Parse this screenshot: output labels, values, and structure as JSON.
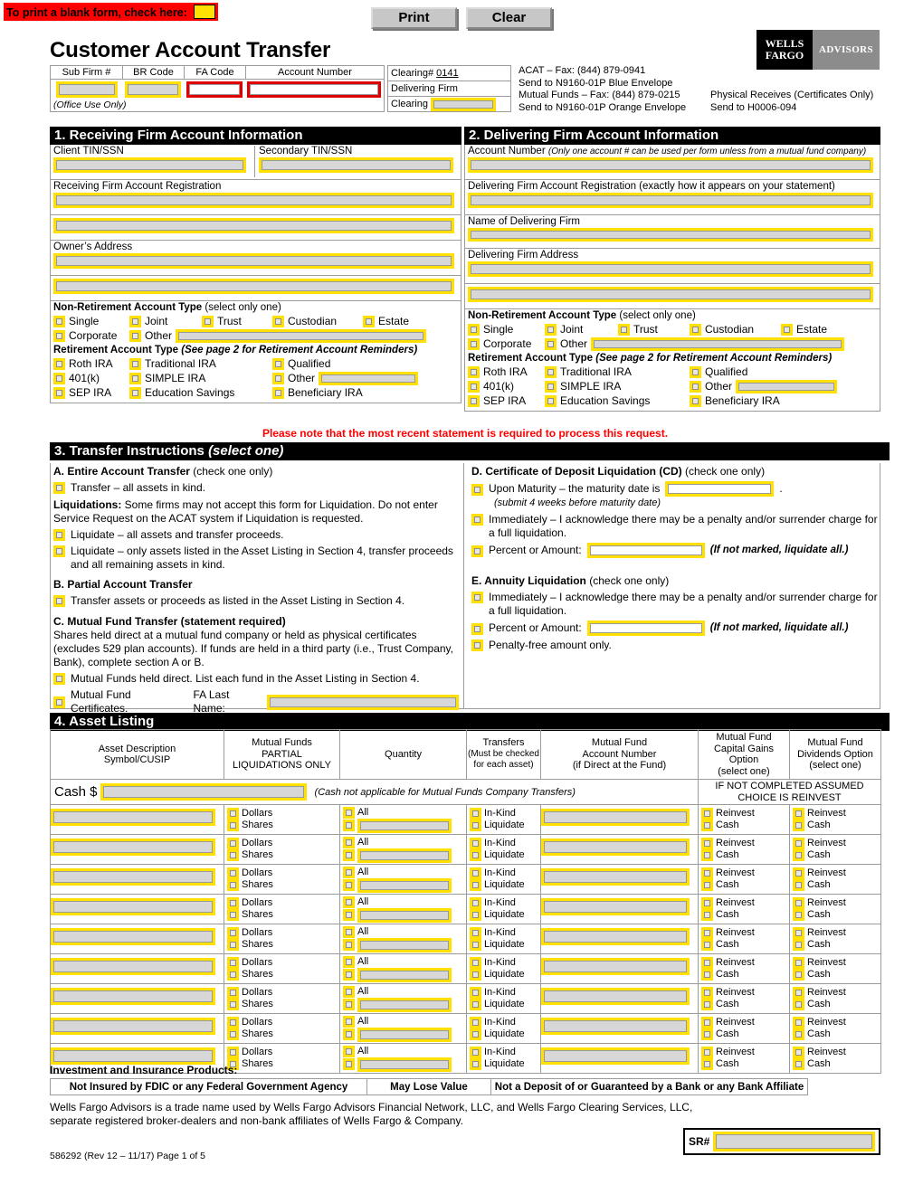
{
  "top": {
    "print_notice": "To print a blank form, check here:",
    "print_button": "Print",
    "clear_button": "Clear"
  },
  "header": {
    "title": "Customer Account Transfer",
    "logo_primary": "WELLS FARGO",
    "logo_secondary": "ADVISORS",
    "office_table": {
      "columns": [
        "Sub Firm #",
        "BR Code",
        "FA Code",
        "Account Number"
      ],
      "note": "(Office Use Only)"
    },
    "clearing": {
      "clearing_label": "Clearing#",
      "clearing_value": "0141",
      "delivering_firm_label": "Delivering Firm",
      "delivering_clearing_label": "Clearing"
    },
    "fax_info": {
      "acat_fax": "ACAT – Fax: (844) 879-0941",
      "acat_send": "Send to N9160-01P Blue Envelope",
      "mf_fax": "Mutual Funds – Fax: (844) 879-0215",
      "mf_send": "Send to N9160-01P Orange Envelope",
      "physical": "Physical Receives (Certificates Only)",
      "physical_send": "Send to H0006-094"
    }
  },
  "section1": {
    "title": "1. Receiving Firm Account Information",
    "client_tin_label": "Client TIN/SSN",
    "secondary_tin_label": "Secondary TIN/SSN",
    "registration_label": "Receiving Firm Account Registration",
    "address_label": "Owner’s Address"
  },
  "section2": {
    "title": "2. Delivering Firm Account Information",
    "account_number_label": "Account Number",
    "account_number_note": "(Only one account # can be used per form unless from a mutual fund company)",
    "registration_label": "Delivering Firm Account Registration (exactly how it appears on your statement)",
    "firm_name_label": "Name of Delivering Firm",
    "address_label": "Delivering Firm Address"
  },
  "account_types": {
    "nonret_heading": "Non-Retirement Account Type",
    "nonret_note": "(select only one)",
    "nonret_row1": [
      "Single",
      "Joint",
      "Trust",
      "Custodian",
      "Estate"
    ],
    "nonret_row2": [
      "Corporate",
      "Other"
    ],
    "ret_heading": "Retirement Account Type",
    "ret_note": "(See page 2 for Retirement Account Reminders)",
    "ret_row1": [
      "Roth IRA",
      "Traditional IRA",
      "Qualified"
    ],
    "ret_row2": [
      "401(k)",
      "SIMPLE IRA",
      "Other"
    ],
    "ret_row3": [
      "SEP IRA",
      "Education Savings",
      "Beneficiary IRA"
    ]
  },
  "red_note": "Please note that the most recent statement is required to process this request.",
  "section3": {
    "title": "3. Transfer Instructions",
    "title_note": "(select one)",
    "a_heading": "A.  Entire Account Transfer",
    "a_note": "(check one only)",
    "a_item1": "Transfer – all assets in kind.",
    "liq_bold": "Liquidations:",
    "liq_text": " Some firms may not accept this form for Liquidation. Do not enter Service Request on the ACAT system if Liquidation is requested.",
    "a_item2": "Liquidate – all assets and transfer proceeds.",
    "a_item3": "Liquidate – only assets listed in the Asset Listing in Section 4, transfer proceeds and all remaining assets in kind.",
    "b_heading": "B.  Partial Account Transfer",
    "b_item1": "Transfer assets or proceeds as listed in the Asset Listing in Section 4.",
    "c_heading": "C.  Mutual Fund Transfer (statement required)",
    "c_text": "Shares held direct at a mutual fund company or held as physical certificates (excludes 529 plan accounts).  If funds are held in a third party (i.e., Trust Company, Bank), complete section A or B.",
    "c_item1": "Mutual Funds held direct. List each fund in the Asset Listing in Section 4.",
    "c_item2": "Mutual Fund Certificates.",
    "c_fa_label": "FA Last Name:",
    "d_heading": "D.  Certificate of Deposit Liquidation (CD)",
    "d_note": "(check one only)",
    "d_item1_pre": "Upon Maturity – the maturity date is",
    "d_item1_post": ".",
    "d_subnote": "(submit 4 weeks before maturity date)",
    "d_item2": "Immediately – I acknowledge there may be a penalty and/or surrender charge for a full liquidation.",
    "d_item3": "Percent or Amount:",
    "d_item3_note": "(If not marked, liquidate all.)",
    "e_heading": "E.  Annuity Liquidation",
    "e_note": "(check one only)",
    "e_item1": "Immediately – I acknowledge there may be a penalty and/or surrender charge for a full liquidation.",
    "e_item2": "Percent or Amount:",
    "e_item2_note": "(If not marked, liquidate all.)",
    "e_item3": "Penalty-free amount only."
  },
  "section4": {
    "title": "4. Asset Listing",
    "columns": [
      "Asset Description\nSymbol/CUSIP",
      "Mutual Funds\nPARTIAL\nLIQUIDATIONS ONLY",
      "Quantity",
      "Transfers\n(Must be checked\nfor each asset)",
      "Mutual Fund\nAccount Number\n(if Direct at the Fund)",
      "Mutual Fund\nCapital Gains Option\n(select one)",
      "Mutual Fund\nDividends Option\n(select one)"
    ],
    "col1_l1": "Asset Description",
    "col1_l2": "Symbol/CUSIP",
    "col2_l1": "Mutual Funds",
    "col2_l2": "PARTIAL",
    "col2_l3": "LIQUIDATIONS ONLY",
    "col3_l1": "Quantity",
    "col4_l1": "Transfers",
    "col4_l2": "(Must be checked",
    "col4_l3": "for each asset)",
    "col5_l1": "Mutual Fund",
    "col5_l2": "Account Number",
    "col5_l3": "(if Direct at the Fund)",
    "col6_l1": "Mutual Fund",
    "col6_l2": "Capital Gains Option",
    "col6_l3": "(select one)",
    "col7_l1": "Mutual Fund",
    "col7_l2": "Dividends Option",
    "col7_l3": "(select one)",
    "cash_label": "Cash $",
    "cash_note": "(Cash not applicable for Mutual Funds Company Transfers)",
    "assumed_l1": "IF NOT COMPLETED ASSUMED",
    "assumed_l2": "CHOICE IS REINVEST",
    "row_options": {
      "dollars": "Dollars",
      "shares": "Shares",
      "all": "All",
      "in_kind": "In-Kind",
      "liquidate": "Liquidate",
      "reinvest": "Reinvest",
      "cash": "Cash"
    },
    "row_count": 9
  },
  "footer": {
    "insurance_heading": "Investment and Insurance Products:",
    "disclosure_cells": [
      "Not Insured by FDIC or any Federal Government Agency",
      "May Lose Value",
      "Not a Deposit of or Guaranteed by a Bank or any Bank Affiliate"
    ],
    "legal_l1": "Wells Fargo Advisors is a trade name used by Wells Fargo Advisors Financial Network, LLC, and Wells Fargo Clearing Services, LLC,",
    "legal_l2": "separate registered broker-dealers and non-bank affiliates of Wells Fargo & Company.",
    "sr_label": "SR#",
    "form_id": "586292 (Rev 12 – 11/17) Page 1 of 5"
  },
  "colors": {
    "field_border": "#ffe000",
    "required_border": "#e00000",
    "alert_red": "#ff0000",
    "section_bar": "#000000"
  }
}
